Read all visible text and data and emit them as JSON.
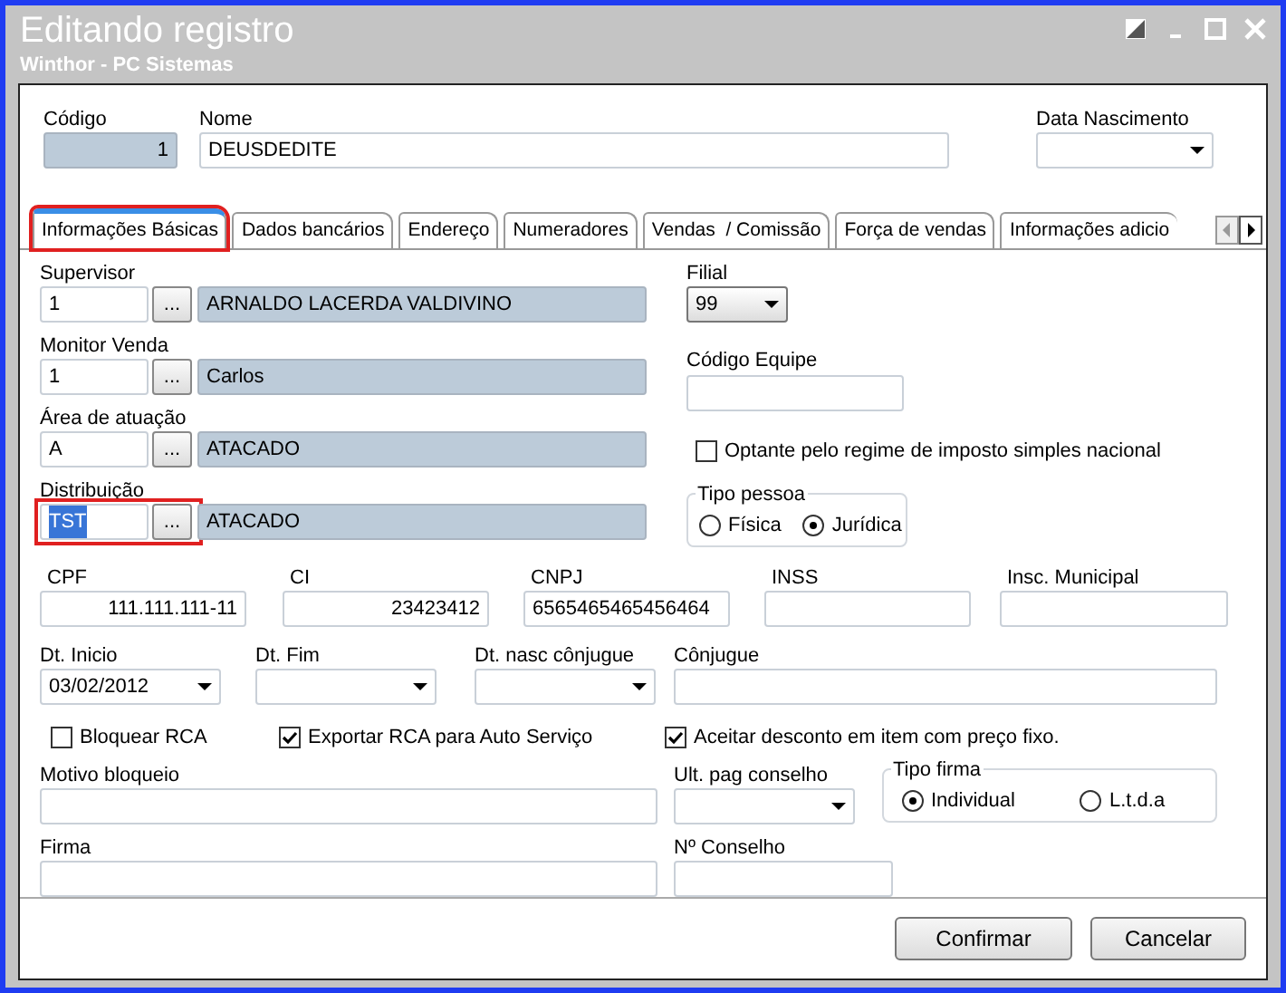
{
  "window": {
    "title": "Editando registro",
    "subtitle": "Winthor - PC Sistemas"
  },
  "header_fields": [
    {
      "label": "Código",
      "value": "1",
      "kind": "readonly"
    },
    {
      "label": "Nome",
      "value": "DEUSDEDITE",
      "kind": "text"
    },
    {
      "label": "Data Nascimento",
      "kind": "dropdown"
    }
  ],
  "tabs": [
    {
      "label": "Informações Básicas",
      "selected": true,
      "highlighted": true
    },
    {
      "label": "Dados bancários",
      "selected": false,
      "highlighted": false
    },
    {
      "label": "Endereço",
      "selected": false,
      "highlighted": false
    },
    {
      "label": "Numeradores",
      "selected": false,
      "highlighted": false
    },
    {
      "label": "Vendas  / Comissão",
      "selected": false,
      "highlighted": false
    },
    {
      "label": "Força de vendas",
      "selected": false,
      "highlighted": false
    },
    {
      "label": "Informações adicio",
      "selected": false,
      "highlighted": false
    }
  ],
  "lookups": [
    {
      "label": "Supervisor",
      "code": "1",
      "button": "...",
      "description": "ARNALDO LACERDA VALDIVINO",
      "highlighted": false,
      "code_selected": false
    },
    {
      "label": "Monitor Venda",
      "code": "1",
      "button": "...",
      "description": "Carlos",
      "highlighted": false,
      "code_selected": false
    },
    {
      "label": "Área de atuação",
      "code": "A",
      "button": "...",
      "description": "ATACADO",
      "highlighted": false,
      "code_selected": false
    },
    {
      "label": "Distribuição",
      "code": "TST",
      "button": "...",
      "description": "ATACADO",
      "highlighted": true,
      "code_selected": true
    }
  ],
  "filial": {
    "label": "Filial",
    "value": "99"
  },
  "codigo_equipe": {
    "label": "Código Equipe"
  },
  "optante": {
    "label": "Optante pelo regime de imposto simples nacional",
    "checked": false
  },
  "tipo_pessoa": {
    "title": "Tipo pessoa",
    "options": [
      {
        "label": "Física",
        "selected": false
      },
      {
        "label": "Jurídica",
        "selected": true
      }
    ]
  },
  "doc_fields": [
    {
      "label": "CPF",
      "value": "111.111.111-11"
    },
    {
      "label": "CI",
      "value": "23423412"
    },
    {
      "label": "CNPJ",
      "value": "6565465465456464"
    },
    {
      "label": "INSS"
    },
    {
      "label": "Insc. Municipal"
    }
  ],
  "date_fields": [
    {
      "label": "Dt. Inicio",
      "value": "03/02/2012",
      "kind": "dropdown"
    },
    {
      "label": "Dt. Fim",
      "kind": "dropdown"
    },
    {
      "label": "Dt. nasc cônjugue",
      "kind": "dropdown"
    },
    {
      "label": "Cônjugue",
      "kind": "text"
    }
  ],
  "checkboxes": [
    {
      "label": "Bloquear RCA",
      "checked": false
    },
    {
      "label": "Exportar RCA para Auto Serviço",
      "checked": true
    },
    {
      "label": "Aceitar desconto em item com preço fixo.",
      "checked": true
    }
  ],
  "motivo_bloqueio": {
    "label": "Motivo bloqueio"
  },
  "ult_pag_conselho": {
    "label": "Ult. pag conselho"
  },
  "tipo_firma": {
    "title": "Tipo firma",
    "options": [
      {
        "label": "Individual",
        "selected": true
      },
      {
        "label": "L.t.d.a",
        "selected": false
      }
    ]
  },
  "firma": {
    "label": "Firma"
  },
  "n_conselho": {
    "label": "Nº Conselho"
  },
  "buttons": [
    {
      "label": "Confirmar"
    },
    {
      "label": "Cancelar"
    }
  ]
}
